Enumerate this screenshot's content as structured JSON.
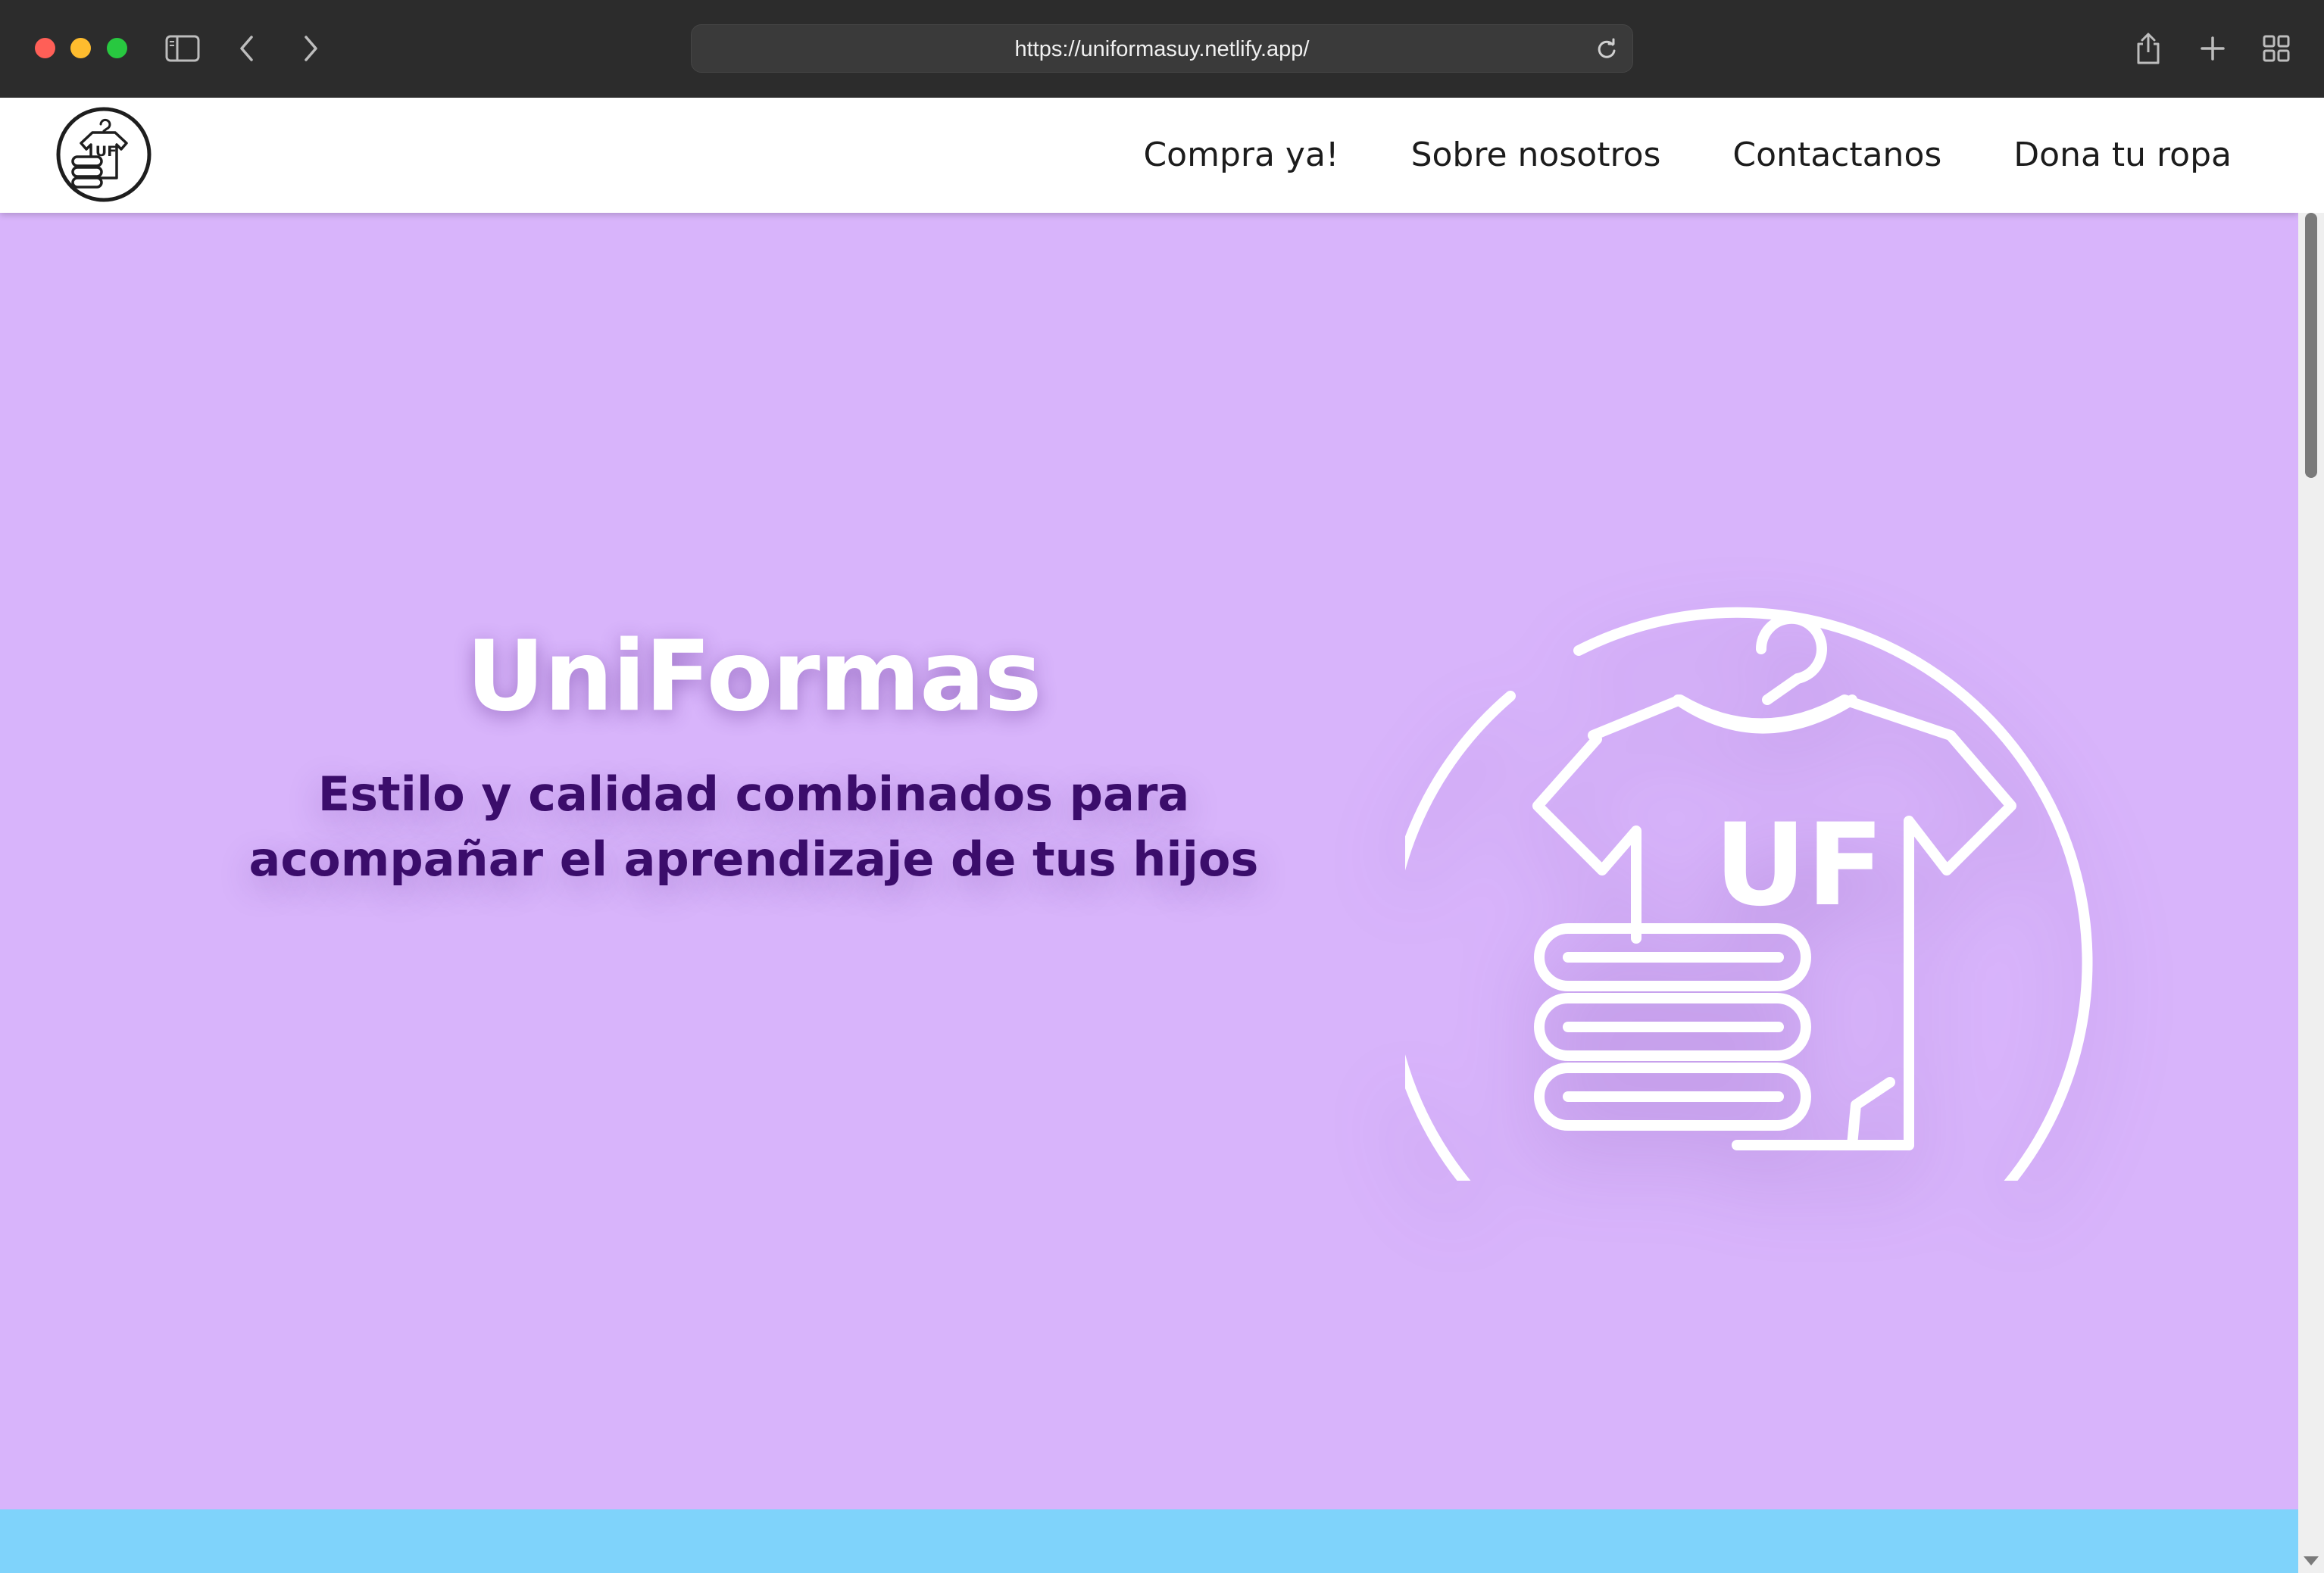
{
  "browser": {
    "url": "https://uniformasuy.netlify.app/",
    "icons": [
      "close-dot",
      "minimize-dot",
      "zoom-dot",
      "sidebar-icon",
      "back-icon",
      "forward-icon",
      "reload-icon",
      "share-icon",
      "new-tab-icon",
      "tab-overview-icon"
    ]
  },
  "navbar": {
    "logo_text": "UF",
    "links": [
      "Compra ya!",
      "Sobre nosotros",
      "Contactanos",
      "Dona tu ropa"
    ]
  },
  "hero": {
    "title": "UniFormas",
    "subtitle_line1": "Estilo y calidad combinados para",
    "subtitle_line2": "acompañar el aprendizaje de tus hijos",
    "icon_text": "UF"
  },
  "colors": {
    "hero_bg": "#d8b4fb",
    "band": "#7fd3fb",
    "subtitle": "#3b0d6b",
    "nav_bg": "#ffffff"
  }
}
